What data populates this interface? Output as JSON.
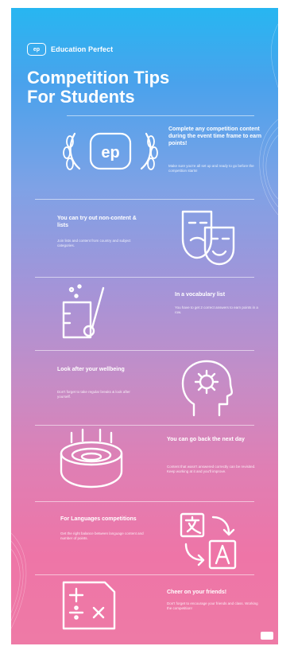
{
  "brand": {
    "badge": "ep",
    "name": "Education Perfect"
  },
  "title": {
    "line1": "Competition Tips",
    "line2": "For Students"
  },
  "sections": [
    {
      "heading": "Complete any competition content during the event time frame to earn points!",
      "body": "Make sure you're all set up and ready to go before the competition starts!",
      "icon": "ep-laurel-icon"
    },
    {
      "heading": "You can try out non-content & lists",
      "body": "Join lists and content from country and subject categories.",
      "icon": "theatre-masks-icon"
    },
    {
      "heading": "In a vocabulary list",
      "body": "You have to get 2 correct answers to earn points in a row.",
      "icon": "science-beaker-icon"
    },
    {
      "heading": "Look after your wellbeing",
      "body": "Don't forget to take regular breaks & look after yourself.",
      "icon": "head-gear-icon"
    },
    {
      "heading": "You can go back the next day",
      "body": "Content that wasn't answered correctly can be revisited. Keep working at it and you'll improve.",
      "icon": "stadium-icon"
    },
    {
      "heading": "For Languages competitions",
      "body": "Get the right balance between language content and number of points.",
      "icon": "translate-icon"
    },
    {
      "heading": "Cheer on your friends!",
      "body": "Don't forget to encourage your friends and class. Working the competition!",
      "icon": "math-operations-icon"
    }
  ]
}
